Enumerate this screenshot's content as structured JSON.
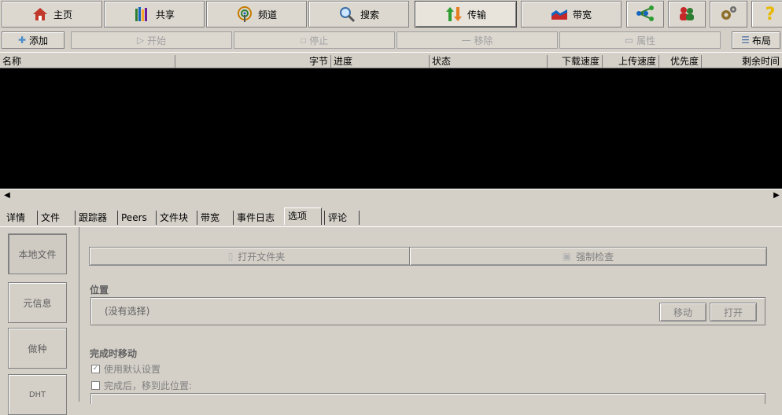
{
  "nav": {
    "home": "主页",
    "share": "共享",
    "channel": "频道",
    "search": "搜索",
    "transfer": "传输",
    "bandwidth": "带宽"
  },
  "toolbar": {
    "add": "添加",
    "start": "开始",
    "stop": "停止",
    "remove": "移除",
    "properties": "属性",
    "layout": "布局"
  },
  "columns": {
    "name": "名称",
    "bytes": "字节",
    "progress": "进度",
    "status": "状态",
    "download_speed": "下载速度",
    "upload_speed": "上传速度",
    "priority": "优先度",
    "remaining": "剩余时间"
  },
  "tabs": [
    "详情",
    "文件",
    "跟踪器",
    "Peers",
    "文件块",
    "带宽",
    "事件日志",
    "选项",
    "评论"
  ],
  "side": {
    "local_files": "本地文件",
    "meta_info": "元信息",
    "seeding": "做种",
    "dht": "DHT"
  },
  "options": {
    "open_folder": "打开文件夹",
    "force_check": "强制检查",
    "location_title": "位置",
    "location_value": "(没有选择)",
    "move": "移动",
    "open": "打开",
    "move_on_complete_title": "完成时移动",
    "use_default": "使用默认设置",
    "move_to_location": "完成后，移到此位置:"
  },
  "colors": {
    "bg": "#d4d0c8",
    "list_bg": "#000000"
  }
}
